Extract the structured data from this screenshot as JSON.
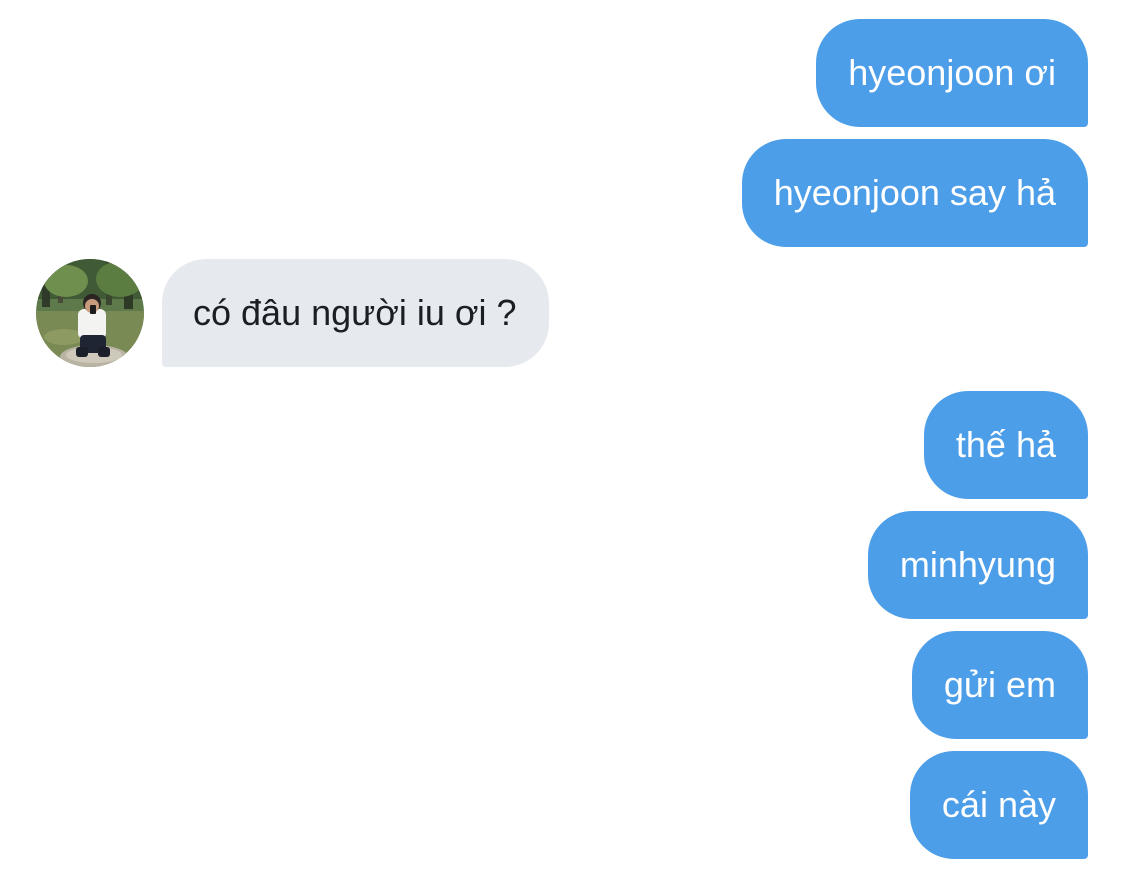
{
  "conversation": {
    "messages": [
      {
        "direction": "outgoing",
        "text": "hyeonjoon ơi"
      },
      {
        "direction": "outgoing",
        "text": "hyeonjoon say hả"
      },
      {
        "direction": "incoming",
        "text": "có đâu người iu ơi ?",
        "avatar": "contact-photo"
      },
      {
        "direction": "outgoing",
        "text": "thế hả"
      },
      {
        "direction": "outgoing",
        "text": "minhyung"
      },
      {
        "direction": "outgoing",
        "text": "gửi em"
      },
      {
        "direction": "outgoing",
        "text": "cái này"
      }
    ]
  },
  "colors": {
    "outgoing_bubble": "#4d9ee9",
    "outgoing_text": "#ffffff",
    "incoming_bubble": "#e6eaee",
    "incoming_text": "#1b1f24",
    "background": "#ffffff"
  }
}
